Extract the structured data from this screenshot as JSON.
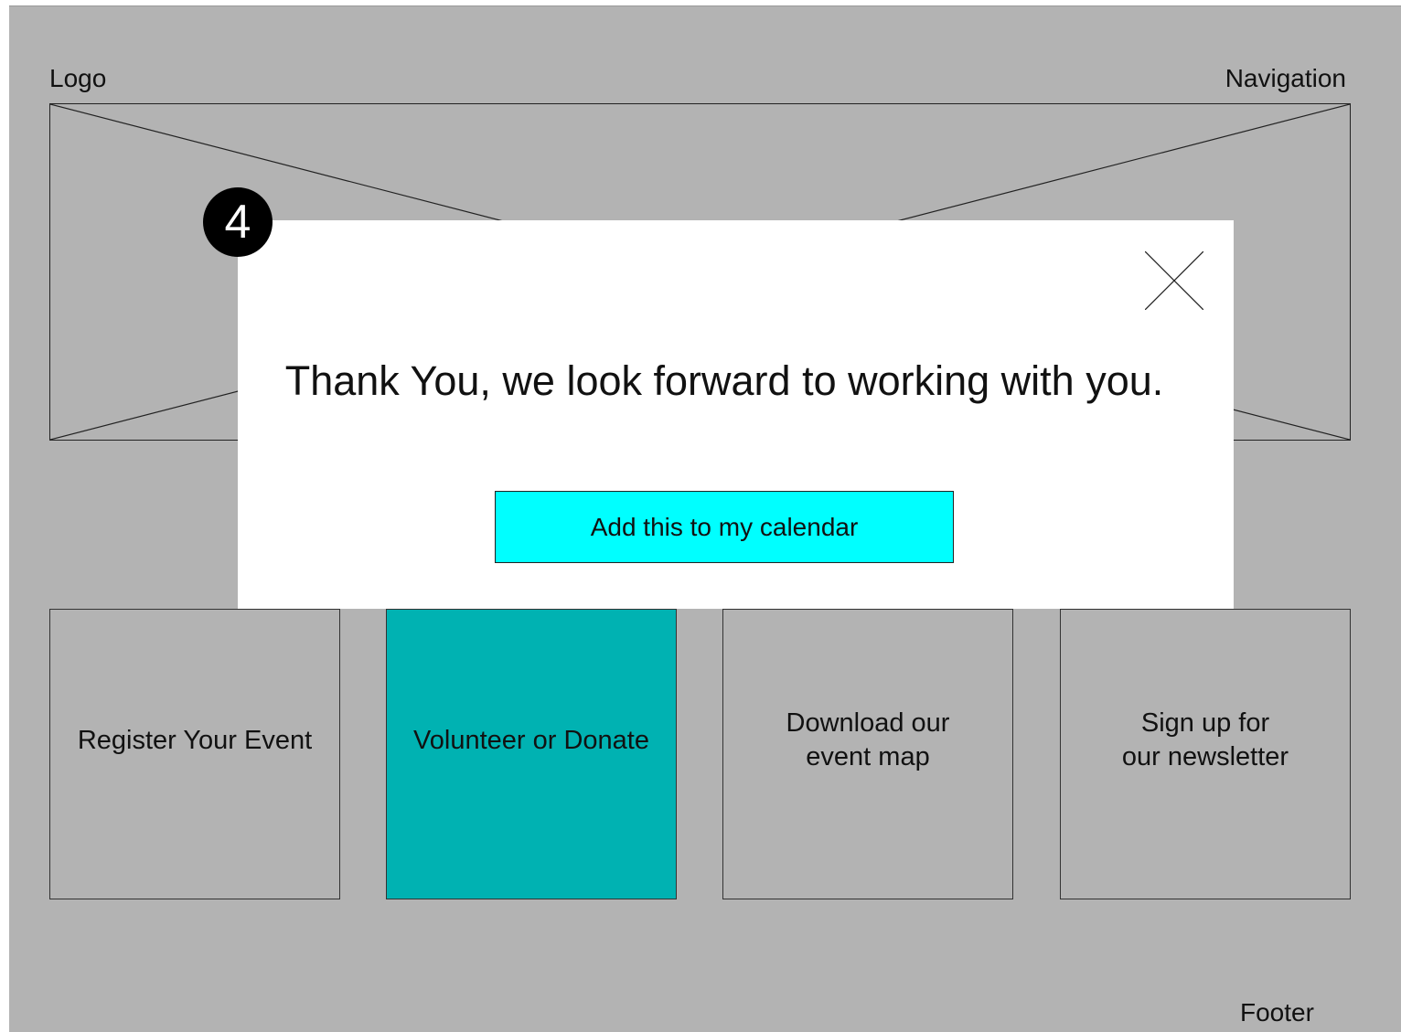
{
  "header": {
    "logo_label": "Logo",
    "nav_label": "Navigation"
  },
  "cards": [
    {
      "label": "Register Your Event"
    },
    {
      "label": "Volunteer or Donate"
    },
    {
      "label": "Download our\n event map"
    },
    {
      "label": "Sign up for\n our newsletter"
    }
  ],
  "footer": {
    "label": "Footer"
  },
  "modal": {
    "message": "Thank You, we look forward to working with you.",
    "calendar_button": "Add this to my calendar",
    "close_icon": "close-icon"
  },
  "annotation": {
    "step_number": "4"
  },
  "colors": {
    "background": "#b3b3b3",
    "active_card": "#00b2b2",
    "calendar_button": "#00ffff",
    "modal": "#ffffff"
  }
}
